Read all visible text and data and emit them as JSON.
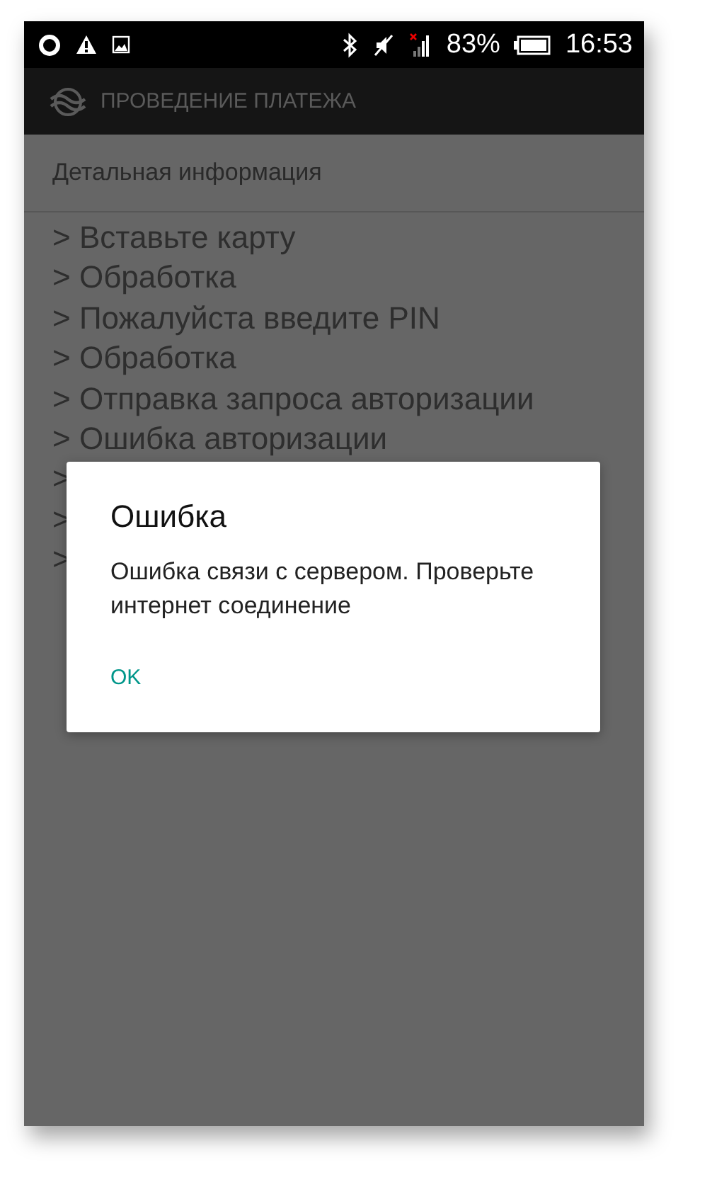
{
  "status_bar": {
    "battery": "83%",
    "time": "16:53"
  },
  "app_bar": {
    "title": "ПРОВЕДЕНИЕ ПЛАТЕЖА"
  },
  "section_header": "Детальная информация",
  "log": [
    {
      "text": "> Вставьте карту"
    },
    {
      "text": "> Обработка"
    },
    {
      "text": "> Пожалуйста введите PIN"
    },
    {
      "text": "> Обработка"
    },
    {
      "text": "> Отправка запроса авторизации"
    },
    {
      "text": "> Ошибка авторизации"
    },
    {
      "text": ">"
    },
    {
      "text": ">"
    },
    {
      "text": ">"
    }
  ],
  "dialog": {
    "title": "Ошибка",
    "message": "Ошибка связи с сервером. Проверьте интернет соединение",
    "buttons": [
      "OK"
    ]
  }
}
